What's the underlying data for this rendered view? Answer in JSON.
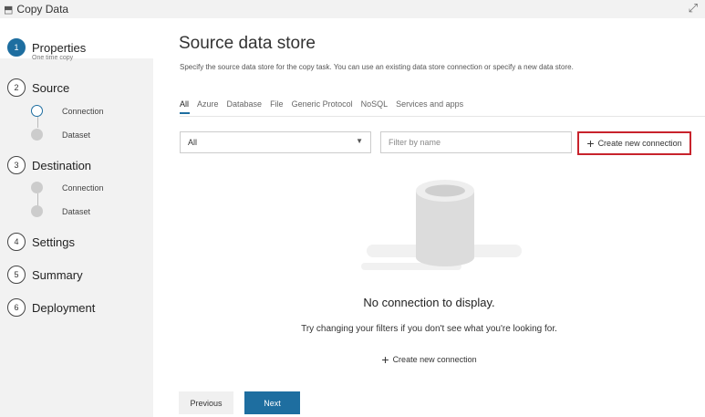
{
  "window": {
    "title": "Copy Data",
    "app_icon": "copy-data-icon",
    "expand_icon": "expand-icon"
  },
  "sidebar": {
    "steps": [
      {
        "number": "1",
        "label": "Properties",
        "sub": "One time copy",
        "state": "active"
      },
      {
        "number": "2",
        "label": "Source",
        "substeps": [
          {
            "label": "Connection",
            "state": "current"
          },
          {
            "label": "Dataset",
            "state": "pending"
          }
        ]
      },
      {
        "number": "3",
        "label": "Destination",
        "substeps": [
          {
            "label": "Connection",
            "state": "pending"
          },
          {
            "label": "Dataset",
            "state": "pending"
          }
        ]
      },
      {
        "number": "4",
        "label": "Settings"
      },
      {
        "number": "5",
        "label": "Summary"
      },
      {
        "number": "6",
        "label": "Deployment"
      }
    ]
  },
  "main": {
    "title": "Source data store",
    "description": "Specify the source data store for the copy task. You can use an existing data store connection or specify a new data store.",
    "tabs": [
      {
        "label": "All",
        "active": true
      },
      {
        "label": "Azure"
      },
      {
        "label": "Database"
      },
      {
        "label": "File"
      },
      {
        "label": "Generic Protocol"
      },
      {
        "label": "NoSQL"
      },
      {
        "label": "Services and apps"
      }
    ],
    "type_filter": {
      "value": "All"
    },
    "name_filter": {
      "placeholder": "Filter by name",
      "value": ""
    },
    "create_button": "Create new connection",
    "empty_state": {
      "title": "No connection to display.",
      "hint": "Try changing your filters if you don't see what you're looking for.",
      "create_link": "Create new connection"
    },
    "footer": {
      "previous": "Previous",
      "next": "Next"
    }
  },
  "colors": {
    "accent": "#1e6ea0",
    "highlight_border": "#c8232c"
  }
}
